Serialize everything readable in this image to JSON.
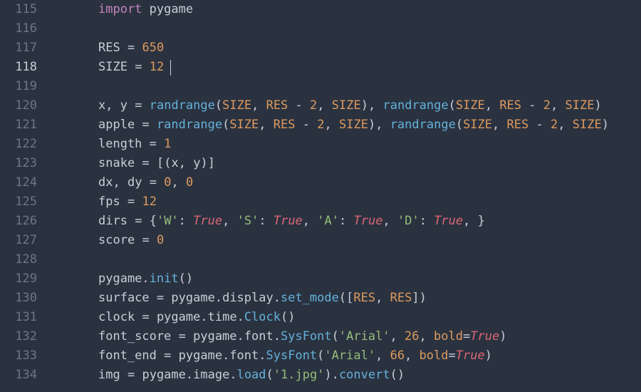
{
  "editor": {
    "current_line": 118,
    "caret_col": 10,
    "lines": [
      {
        "num": 115,
        "tokens": [
          [
            "kw",
            "import"
          ],
          [
            "sp",
            " "
          ],
          [
            "ident",
            "pygame"
          ]
        ]
      },
      {
        "num": 116,
        "tokens": []
      },
      {
        "num": 117,
        "tokens": [
          [
            "ident",
            "RES"
          ],
          [
            "sp",
            " "
          ],
          [
            "op",
            "="
          ],
          [
            "sp",
            " "
          ],
          [
            "num",
            "650"
          ]
        ]
      },
      {
        "num": 118,
        "tokens": [
          [
            "ident",
            "SIZE"
          ],
          [
            "sp",
            " "
          ],
          [
            "op",
            "="
          ],
          [
            "sp",
            " "
          ],
          [
            "num",
            "12"
          ]
        ]
      },
      {
        "num": 119,
        "tokens": []
      },
      {
        "num": 120,
        "tokens": [
          [
            "ident",
            "x"
          ],
          [
            "punct",
            ","
          ],
          [
            "sp",
            " "
          ],
          [
            "ident",
            "y"
          ],
          [
            "sp",
            " "
          ],
          [
            "op",
            "="
          ],
          [
            "sp",
            " "
          ],
          [
            "func",
            "randrange"
          ],
          [
            "punct",
            "("
          ],
          [
            "upper",
            "SIZE"
          ],
          [
            "punct",
            ","
          ],
          [
            "sp",
            " "
          ],
          [
            "upper",
            "RES"
          ],
          [
            "sp",
            " "
          ],
          [
            "op",
            "-"
          ],
          [
            "sp",
            " "
          ],
          [
            "num",
            "2"
          ],
          [
            "punct",
            ","
          ],
          [
            "sp",
            " "
          ],
          [
            "upper",
            "SIZE"
          ],
          [
            "punct",
            ")"
          ],
          [
            "punct",
            ","
          ],
          [
            "sp",
            " "
          ],
          [
            "func",
            "randrange"
          ],
          [
            "punct",
            "("
          ],
          [
            "upper",
            "SIZE"
          ],
          [
            "punct",
            ","
          ],
          [
            "sp",
            " "
          ],
          [
            "upper",
            "RES"
          ],
          [
            "sp",
            " "
          ],
          [
            "op",
            "-"
          ],
          [
            "sp",
            " "
          ],
          [
            "num",
            "2"
          ],
          [
            "punct",
            ","
          ],
          [
            "sp",
            " "
          ],
          [
            "upper",
            "SIZE"
          ],
          [
            "punct",
            ")"
          ]
        ]
      },
      {
        "num": 121,
        "tokens": [
          [
            "ident",
            "apple"
          ],
          [
            "sp",
            " "
          ],
          [
            "op",
            "="
          ],
          [
            "sp",
            " "
          ],
          [
            "func",
            "randrange"
          ],
          [
            "punct",
            "("
          ],
          [
            "upper",
            "SIZE"
          ],
          [
            "punct",
            ","
          ],
          [
            "sp",
            " "
          ],
          [
            "upper",
            "RES"
          ],
          [
            "sp",
            " "
          ],
          [
            "op",
            "-"
          ],
          [
            "sp",
            " "
          ],
          [
            "num",
            "2"
          ],
          [
            "punct",
            ","
          ],
          [
            "sp",
            " "
          ],
          [
            "upper",
            "SIZE"
          ],
          [
            "punct",
            ")"
          ],
          [
            "punct",
            ","
          ],
          [
            "sp",
            " "
          ],
          [
            "func",
            "randrange"
          ],
          [
            "punct",
            "("
          ],
          [
            "upper",
            "SIZE"
          ],
          [
            "punct",
            ","
          ],
          [
            "sp",
            " "
          ],
          [
            "upper",
            "RES"
          ],
          [
            "sp",
            " "
          ],
          [
            "op",
            "-"
          ],
          [
            "sp",
            " "
          ],
          [
            "num",
            "2"
          ],
          [
            "punct",
            ","
          ],
          [
            "sp",
            " "
          ],
          [
            "upper",
            "SIZE"
          ],
          [
            "punct",
            ")"
          ]
        ]
      },
      {
        "num": 122,
        "tokens": [
          [
            "ident",
            "length"
          ],
          [
            "sp",
            " "
          ],
          [
            "op",
            "="
          ],
          [
            "sp",
            " "
          ],
          [
            "num",
            "1"
          ]
        ]
      },
      {
        "num": 123,
        "tokens": [
          [
            "ident",
            "snake"
          ],
          [
            "sp",
            " "
          ],
          [
            "op",
            "="
          ],
          [
            "sp",
            " "
          ],
          [
            "punct",
            "["
          ],
          [
            "punct",
            "("
          ],
          [
            "ident",
            "x"
          ],
          [
            "punct",
            ","
          ],
          [
            "sp",
            " "
          ],
          [
            "ident",
            "y"
          ],
          [
            "punct",
            ")"
          ],
          [
            "punct",
            "]"
          ]
        ]
      },
      {
        "num": 124,
        "tokens": [
          [
            "ident",
            "dx"
          ],
          [
            "punct",
            ","
          ],
          [
            "sp",
            " "
          ],
          [
            "ident",
            "dy"
          ],
          [
            "sp",
            " "
          ],
          [
            "op",
            "="
          ],
          [
            "sp",
            " "
          ],
          [
            "num",
            "0"
          ],
          [
            "punct",
            ","
          ],
          [
            "sp",
            " "
          ],
          [
            "num",
            "0"
          ]
        ]
      },
      {
        "num": 125,
        "tokens": [
          [
            "ident",
            "fps"
          ],
          [
            "sp",
            " "
          ],
          [
            "op",
            "="
          ],
          [
            "sp",
            " "
          ],
          [
            "num",
            "12"
          ]
        ]
      },
      {
        "num": 126,
        "tokens": [
          [
            "ident",
            "dirs"
          ],
          [
            "sp",
            " "
          ],
          [
            "op",
            "="
          ],
          [
            "sp",
            " "
          ],
          [
            "punct",
            "{"
          ],
          [
            "str",
            "'W'"
          ],
          [
            "punct",
            ":"
          ],
          [
            "sp",
            " "
          ],
          [
            "bool",
            "True"
          ],
          [
            "punct",
            ","
          ],
          [
            "sp",
            " "
          ],
          [
            "str",
            "'S'"
          ],
          [
            "punct",
            ":"
          ],
          [
            "sp",
            " "
          ],
          [
            "bool",
            "True"
          ],
          [
            "punct",
            ","
          ],
          [
            "sp",
            " "
          ],
          [
            "str",
            "'A'"
          ],
          [
            "punct",
            ":"
          ],
          [
            "sp",
            " "
          ],
          [
            "bool",
            "True"
          ],
          [
            "punct",
            ","
          ],
          [
            "sp",
            " "
          ],
          [
            "str",
            "'D'"
          ],
          [
            "punct",
            ":"
          ],
          [
            "sp",
            " "
          ],
          [
            "bool",
            "True"
          ],
          [
            "punct",
            ","
          ],
          [
            "sp",
            " "
          ],
          [
            "punct",
            "}"
          ]
        ]
      },
      {
        "num": 127,
        "tokens": [
          [
            "ident",
            "score"
          ],
          [
            "sp",
            " "
          ],
          [
            "op",
            "="
          ],
          [
            "sp",
            " "
          ],
          [
            "num",
            "0"
          ]
        ]
      },
      {
        "num": 128,
        "tokens": []
      },
      {
        "num": 129,
        "tokens": [
          [
            "ident",
            "pygame"
          ],
          [
            "punct",
            "."
          ],
          [
            "func",
            "init"
          ],
          [
            "punct",
            "("
          ],
          [
            "punct",
            ")"
          ]
        ]
      },
      {
        "num": 130,
        "tokens": [
          [
            "ident",
            "surface"
          ],
          [
            "sp",
            " "
          ],
          [
            "op",
            "="
          ],
          [
            "sp",
            " "
          ],
          [
            "ident",
            "pygame"
          ],
          [
            "punct",
            "."
          ],
          [
            "ident",
            "display"
          ],
          [
            "punct",
            "."
          ],
          [
            "func",
            "set_mode"
          ],
          [
            "punct",
            "("
          ],
          [
            "punct",
            "["
          ],
          [
            "upper",
            "RES"
          ],
          [
            "punct",
            ","
          ],
          [
            "sp",
            " "
          ],
          [
            "upper",
            "RES"
          ],
          [
            "punct",
            "]"
          ],
          [
            "punct",
            ")"
          ]
        ]
      },
      {
        "num": 131,
        "tokens": [
          [
            "ident",
            "clock"
          ],
          [
            "sp",
            " "
          ],
          [
            "op",
            "="
          ],
          [
            "sp",
            " "
          ],
          [
            "ident",
            "pygame"
          ],
          [
            "punct",
            "."
          ],
          [
            "ident",
            "time"
          ],
          [
            "punct",
            "."
          ],
          [
            "func",
            "Clock"
          ],
          [
            "punct",
            "("
          ],
          [
            "punct",
            ")"
          ]
        ]
      },
      {
        "num": 132,
        "tokens": [
          [
            "ident",
            "font_score"
          ],
          [
            "sp",
            " "
          ],
          [
            "op",
            "="
          ],
          [
            "sp",
            " "
          ],
          [
            "ident",
            "pygame"
          ],
          [
            "punct",
            "."
          ],
          [
            "ident",
            "font"
          ],
          [
            "punct",
            "."
          ],
          [
            "func",
            "SysFont"
          ],
          [
            "punct",
            "("
          ],
          [
            "str",
            "'Arial'"
          ],
          [
            "punct",
            ","
          ],
          [
            "sp",
            " "
          ],
          [
            "num",
            "26"
          ],
          [
            "punct",
            ","
          ],
          [
            "sp",
            " "
          ],
          [
            "param",
            "bold"
          ],
          [
            "op",
            "="
          ],
          [
            "bool",
            "True"
          ],
          [
            "punct",
            ")"
          ]
        ]
      },
      {
        "num": 133,
        "tokens": [
          [
            "ident",
            "font_end"
          ],
          [
            "sp",
            " "
          ],
          [
            "op",
            "="
          ],
          [
            "sp",
            " "
          ],
          [
            "ident",
            "pygame"
          ],
          [
            "punct",
            "."
          ],
          [
            "ident",
            "font"
          ],
          [
            "punct",
            "."
          ],
          [
            "func",
            "SysFont"
          ],
          [
            "punct",
            "("
          ],
          [
            "str",
            "'Arial'"
          ],
          [
            "punct",
            ","
          ],
          [
            "sp",
            " "
          ],
          [
            "num",
            "66"
          ],
          [
            "punct",
            ","
          ],
          [
            "sp",
            " "
          ],
          [
            "param",
            "bold"
          ],
          [
            "op",
            "="
          ],
          [
            "bool",
            "True"
          ],
          [
            "punct",
            ")"
          ]
        ]
      },
      {
        "num": 134,
        "tokens": [
          [
            "ident",
            "img"
          ],
          [
            "sp",
            " "
          ],
          [
            "op",
            "="
          ],
          [
            "sp",
            " "
          ],
          [
            "ident",
            "pygame"
          ],
          [
            "punct",
            "."
          ],
          [
            "ident",
            "image"
          ],
          [
            "punct",
            "."
          ],
          [
            "func",
            "load"
          ],
          [
            "punct",
            "("
          ],
          [
            "str",
            "'1.jpg'"
          ],
          [
            "punct",
            ")"
          ],
          [
            "punct",
            "."
          ],
          [
            "func",
            "convert"
          ],
          [
            "punct",
            "("
          ],
          [
            "punct",
            ")"
          ]
        ]
      }
    ]
  }
}
